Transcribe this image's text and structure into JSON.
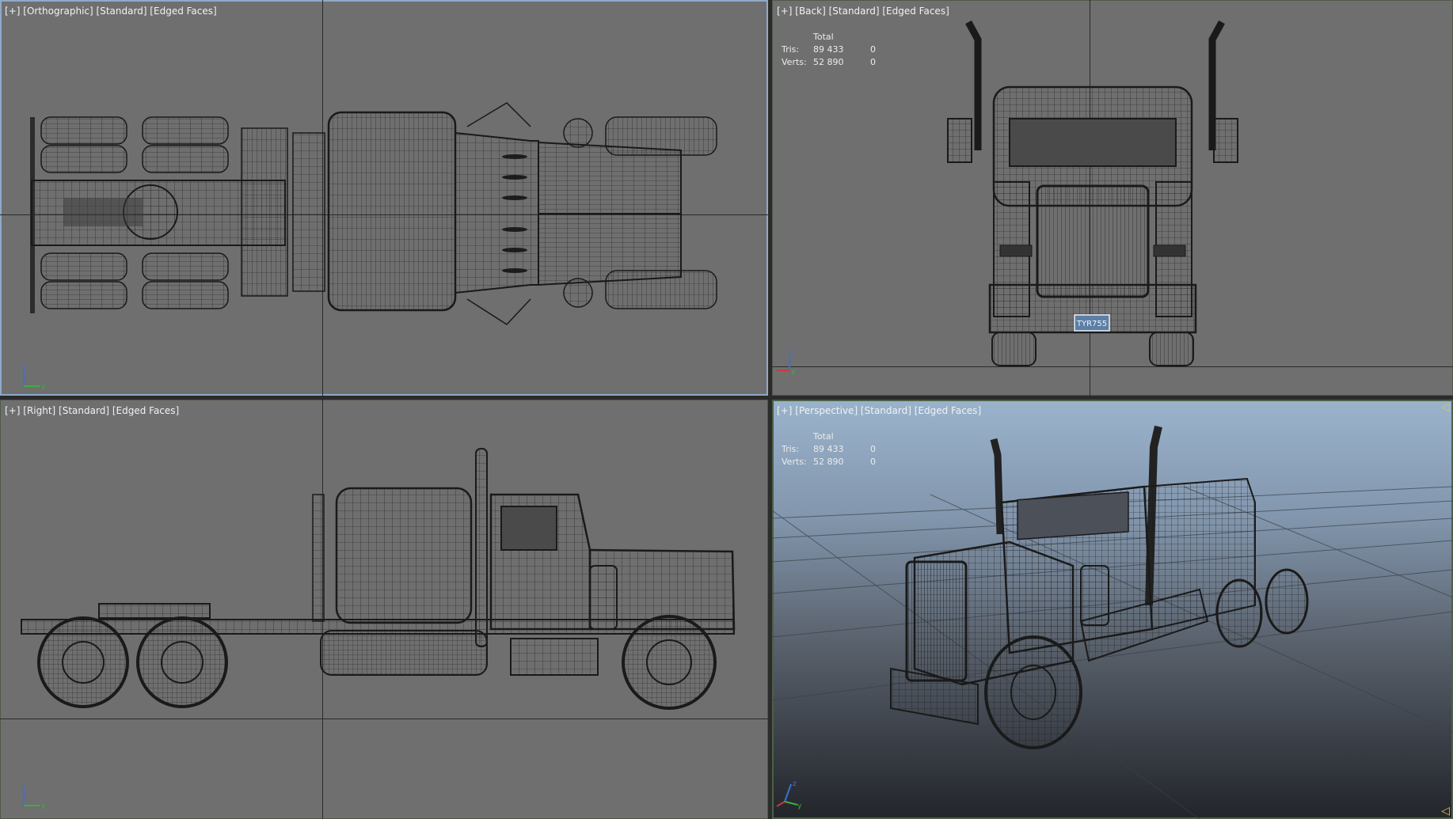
{
  "viewports": {
    "top": {
      "label_parts": [
        "[",
        "+",
        "] [",
        "Orthographic",
        "] [",
        "Standard",
        "] [",
        "Edged Faces",
        "]"
      ],
      "plus": "+",
      "view": "Orthographic",
      "shading": "Standard",
      "faces": "Edged Faces"
    },
    "back": {
      "plus": "+",
      "view": "Back",
      "shading": "Standard",
      "faces": "Edged Faces",
      "stats": {
        "header": "Total",
        "tris_label": "Tris:",
        "tris_total": "89 433",
        "tris_sel": "0",
        "verts_label": "Verts:",
        "verts_total": "52 890",
        "verts_sel": "0"
      },
      "plate": "TYR755"
    },
    "right": {
      "plus": "+",
      "view": "Right",
      "shading": "Standard",
      "faces": "Edged Faces"
    },
    "perspective": {
      "plus": "+",
      "view": "Perspective",
      "shading": "Standard",
      "faces": "Edged Faces",
      "stats": {
        "header": "Total",
        "tris_label": "Tris:",
        "tris_total": "89 433",
        "tris_sel": "0",
        "verts_label": "Verts:",
        "verts_total": "52 890",
        "verts_sel": "0"
      }
    }
  },
  "axis_labels": {
    "z": "z",
    "y": "y",
    "x": "x"
  },
  "colors": {
    "viewport_bg": "#6f6f6f",
    "active_border": "#8fa9c9",
    "axis_z": "#3b6fd4",
    "axis_y": "#3fae3f",
    "axis_x": "#c83a3a",
    "label_text": "#f2f2f2"
  }
}
